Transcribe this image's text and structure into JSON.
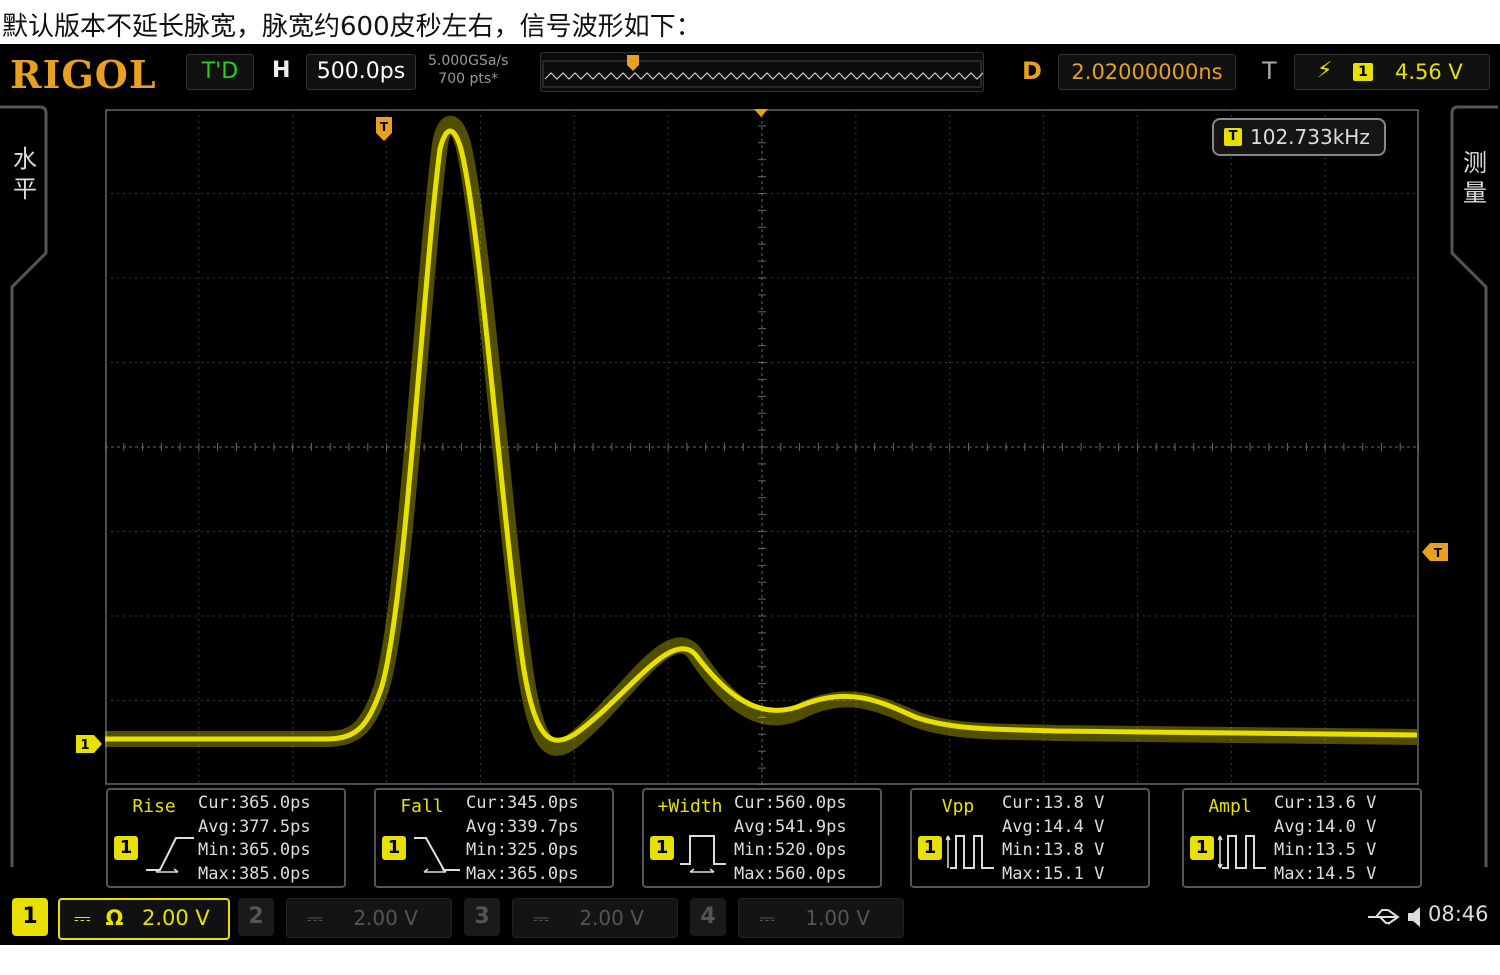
{
  "caption": "默认版本不延长脉宽，脉宽约600皮秒左右，信号波形如下：",
  "brand": "RIGOL",
  "run_state": "T'D",
  "horizontal": {
    "label": "H",
    "timebase": "500.0ps",
    "sample_rate": "5.000GSa/s",
    "memory_depth": "700  pts*"
  },
  "delay": {
    "label": "D",
    "value": "2.02000000ns"
  },
  "trigger": {
    "label": "T",
    "edge_icon": "rising-edge-icon",
    "channel": "1",
    "level": "4.56 V"
  },
  "side_tabs": {
    "left": [
      "水",
      "平"
    ],
    "right": [
      "测",
      "量"
    ]
  },
  "frequency_counter": {
    "badge": "T",
    "value": "102.733kHz"
  },
  "markers": {
    "trigger_position": "T",
    "trigger_level": "T",
    "channel1_ground": "1"
  },
  "measurements": [
    {
      "name": "Rise",
      "icon": "rise-edge-icon",
      "channel": "1",
      "cur": "Cur:365.0ps",
      "avg": "Avg:377.5ps",
      "min": "Min:365.0ps",
      "max": "Max:385.0ps"
    },
    {
      "name": "Fall",
      "icon": "fall-edge-icon",
      "channel": "1",
      "cur": "Cur:345.0ps",
      "avg": "Avg:339.7ps",
      "min": "Min:325.0ps",
      "max": "Max:365.0ps"
    },
    {
      "name": "+Width",
      "icon": "pulse-width-icon",
      "channel": "1",
      "cur": "Cur:560.0ps",
      "avg": "Avg:541.9ps",
      "min": "Min:520.0ps",
      "max": "Max:560.0ps"
    },
    {
      "name": "Vpp",
      "icon": "peak-peak-icon",
      "channel": "1",
      "cur": "Cur:13.8 V",
      "avg": "Avg:14.4 V",
      "min": "Min:13.8 V",
      "max": "Max:15.1 V"
    },
    {
      "name": "Ampl",
      "icon": "amplitude-icon",
      "channel": "1",
      "cur": "Cur:13.6 V",
      "avg": "Avg:14.0 V",
      "min": "Min:13.5 V",
      "max": "Max:14.5 V"
    }
  ],
  "channels": [
    {
      "num": "1",
      "coupling": "⎓",
      "impedance": "Ω",
      "scale": "2.00 V",
      "active": true,
      "color": "#e8e000"
    },
    {
      "num": "2",
      "coupling": "⎓",
      "scale": "2.00 V",
      "active": false
    },
    {
      "num": "3",
      "coupling": "⎓",
      "scale": "2.00 V",
      "active": false
    },
    {
      "num": "4",
      "coupling": "⎓",
      "scale": "1.00 V",
      "active": false
    }
  ],
  "status": {
    "usb_icon": "usb-icon",
    "speaker_icon": "speaker-icon",
    "time": "08:46"
  },
  "colors": {
    "ch1": "#e8e000",
    "trigger_marker": "#e8a020",
    "background": "#000000"
  }
}
